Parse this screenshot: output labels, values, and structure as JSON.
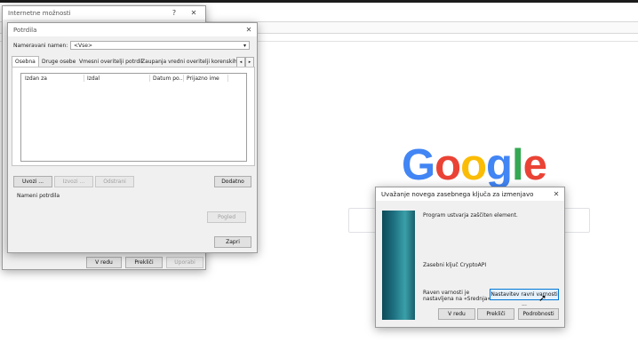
{
  "internet_options": {
    "title": "Internetne možnosti",
    "help": "?",
    "close": "✕",
    "buttons": {
      "ok": "V redu",
      "cancel": "Prekliči",
      "apply": "Uporabi"
    }
  },
  "certificates": {
    "title": "Potrdila",
    "close": "✕",
    "purpose_label": "Nameravani namen:",
    "purpose_value": "<Vse>",
    "tabs": [
      "Osebna",
      "Druge osebe",
      "Vmesni overitelji potrdil",
      "Zaupanja vredni overitelji korenskih potrd"
    ],
    "tab_prev": "◂",
    "tab_next": "▸",
    "columns": [
      "Izdan za",
      "Izdal",
      "Datum po...",
      "Prijazno ime"
    ],
    "buttons": {
      "import": "Uvozi ...",
      "export": "Izvozi ...",
      "remove": "Odstrani",
      "advanced": "Dodatno",
      "view": "Pogled",
      "close": "Zapri"
    },
    "purposes_label": "Nameni potrdila"
  },
  "private_key": {
    "title": "Uvažanje novega zasebnega ključa za izmenjavo",
    "close": "✕",
    "message": "Program ustvarja zaščiten element.",
    "key_label": "Zasebni ključ CryptoAPI",
    "level_text_1": "Raven varnosti je",
    "level_text_2": "nastavljena na «Srednja»",
    "set_level_button": "Nastavitev ravni varnosti ...",
    "buttons": {
      "ok": "V redu",
      "cancel": "Prekliči",
      "details": "Podrobnosti"
    }
  },
  "google": {
    "letters": [
      "G",
      "o",
      "o",
      "g",
      "l",
      "e"
    ]
  }
}
